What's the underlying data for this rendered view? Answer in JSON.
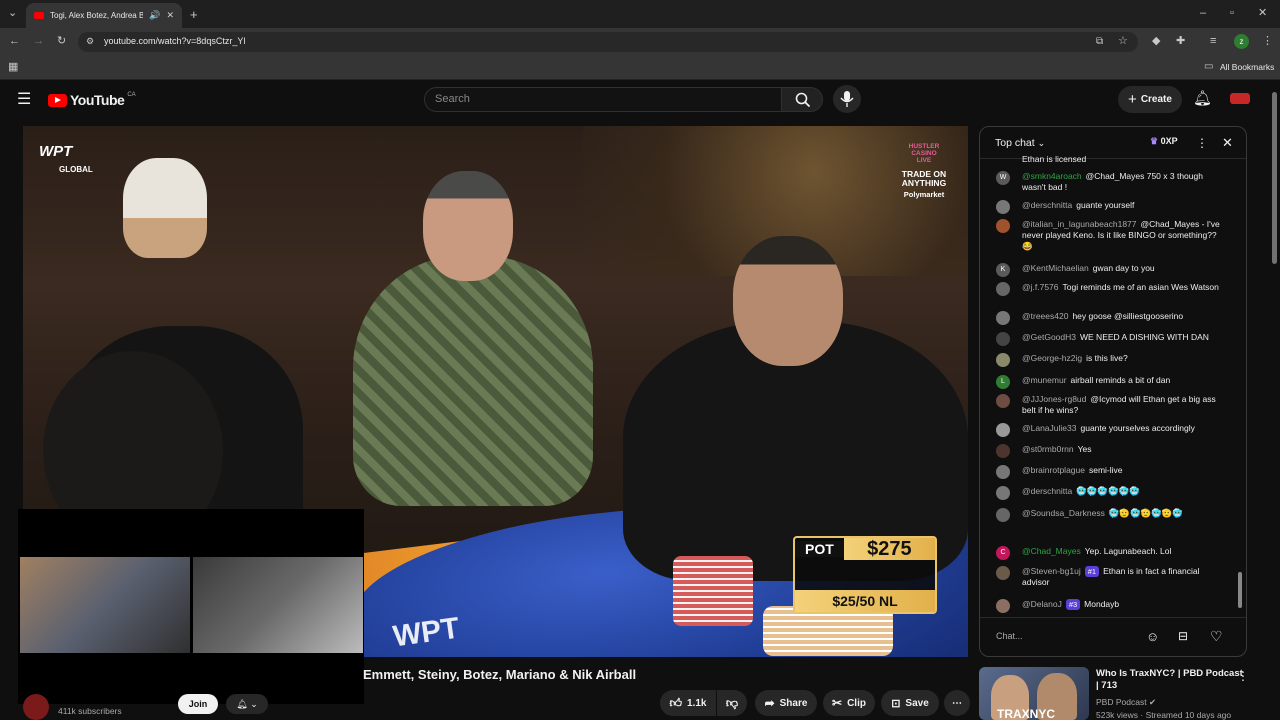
{
  "browser": {
    "tab_title": "Togi, Alex Botez, Andrea Bo",
    "url": "youtube.com/watch?v=8dqsCtzr_Yl",
    "bookmarks_label": "All Bookmarks",
    "profile_letter": "z"
  },
  "header": {
    "logo": "YouTube",
    "country": "CA",
    "search_placeholder": "Search",
    "create_label": "Create"
  },
  "video": {
    "wpt_logo": "WPT",
    "wpt_sub": "GLOBAL",
    "sponsor_line1": "HUSTLER",
    "sponsor_line2": "CASINO",
    "sponsor_line3": "LIVE",
    "sponsor_tag": "TRADE ON ANYTHING",
    "sponsor_brand": "Polymarket",
    "pot_label": "POT",
    "pot_amount": "$275",
    "blinds": "$25/50 NL",
    "table_logo": "WPT"
  },
  "chat": {
    "header": "Top chat",
    "xp": "0XP",
    "input_placeholder": "Chat...",
    "messages": [
      {
        "avatar": "",
        "user": "",
        "text": "Ethan is licensed",
        "color": "#555"
      },
      {
        "avatar": "W",
        "user": "@smkn4aroach",
        "text": "@Chad_Mayes 750 x 3 though wasn't bad !",
        "member": true,
        "color": "#5a5a5a"
      },
      {
        "avatar": "",
        "user": "@derschnitta",
        "text": "guante yourself",
        "color": "#777"
      },
      {
        "avatar": "",
        "user": "@italian_in_lagunabeach1877",
        "text": "@Chad_Mayes - I've never played Keno. Is it like BINGO or something?? 😂",
        "color": "#a0522d"
      },
      {
        "avatar": "K",
        "user": "@KentMichaelian",
        "text": "gwan day to you",
        "color": "#5a5a5a"
      },
      {
        "avatar": "",
        "user": "@j.f.7576",
        "text": "Togi reminds me of an asian Wes Watson",
        "color": "#666"
      },
      {
        "avatar": "",
        "user": "@treees420",
        "text": "hey goose @silliestgooserino",
        "color": "#777"
      },
      {
        "avatar": "",
        "user": "@GetGoodH3",
        "text": "WE NEED A DISHING WITH DAN",
        "color": "#444"
      },
      {
        "avatar": "",
        "user": "@George-hz2ig",
        "text": "is this live?",
        "color": "#8a8a6a"
      },
      {
        "avatar": "L",
        "user": "@munemur",
        "text": "airball reminds a bit of dan",
        "color": "#2e7d32"
      },
      {
        "avatar": "",
        "user": "@JJJones-rg8ud",
        "text": "@Icymod will Ethan get a big ass belt if he wins?",
        "color": "#6d4c41"
      },
      {
        "avatar": "",
        "user": "@LanaJulie33",
        "text": "guante yourselves accordingly",
        "color": "#999"
      },
      {
        "avatar": "",
        "user": "@st0rmb0rnn",
        "text": "Yes",
        "color": "#4e342e"
      },
      {
        "avatar": "",
        "user": "@brainrotplague",
        "text": "semi-live",
        "color": "#777"
      },
      {
        "avatar": "",
        "user": "@derschnitta",
        "text": "🥶🥶🥶🥶🥶🥶",
        "color": "#777"
      },
      {
        "avatar": "",
        "user": "@Soundsa_Darkness",
        "text": "🥶🫡🥶🫡🥶🫡🥶",
        "color": "#666"
      },
      {
        "avatar": "C",
        "user": "@Chad_Mayes",
        "text": "Yep. Lagunabeach. Lol",
        "member": true,
        "color": "#c2185b"
      },
      {
        "avatar": "",
        "user": "@Steven-bg1uj",
        "badge": "#1",
        "text": "Ethan is in fact a financial advisor",
        "color": "#6a5a4a"
      },
      {
        "avatar": "",
        "user": "@DelanoJ",
        "badge": "#3",
        "text": "Mondayb",
        "color": "#8d6e63"
      }
    ]
  },
  "below": {
    "title": "Emmett, Steiny, Botez, Mariano & Nik Airball",
    "subscribers": "411k subscribers",
    "join": "Join",
    "likes": "1.1k",
    "share": "Share",
    "clip": "Clip",
    "save": "Save"
  },
  "recommended": {
    "title": "Who Is TraxNYC? | PBD Podcast | 713",
    "channel": "PBD Podcast",
    "meta": "523k views · Streamed 10 days ago",
    "thumb_text": "TRAXNYC"
  }
}
